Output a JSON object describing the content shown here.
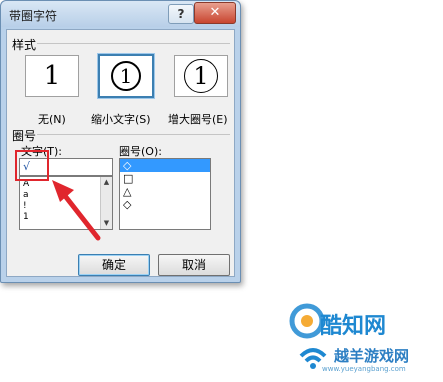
{
  "window": {
    "title": "带圈字符",
    "help_glyph": "?",
    "close_glyph": "✕"
  },
  "style_section": {
    "label": "样式",
    "options": [
      {
        "label": "无(N)",
        "glyph": "1",
        "selected": false
      },
      {
        "label": "缩小文字(S)",
        "glyph": "1",
        "selected": true
      },
      {
        "label": "增大圈号(E)",
        "glyph": "1",
        "selected": false
      }
    ]
  },
  "enclosure_section": {
    "label": "圈号",
    "text_label": "文字(T):",
    "text_value": "√",
    "text_list": [
      "A",
      "a",
      "!",
      "1"
    ],
    "enclosure_label": "圈号(O):",
    "enclosure_list": [
      "◇",
      "□",
      "△",
      "◇"
    ],
    "enclosure_selected_index": 0
  },
  "buttons": {
    "ok": "确定",
    "cancel": "取消"
  },
  "watermark": {
    "logo_text": "酷知网",
    "site_name": "越羊游戏网",
    "url": "www.yueyangbang.com"
  },
  "colors": {
    "highlight": "#e0262d",
    "selection": "#3399ff",
    "watermark": "#1e88d1"
  }
}
